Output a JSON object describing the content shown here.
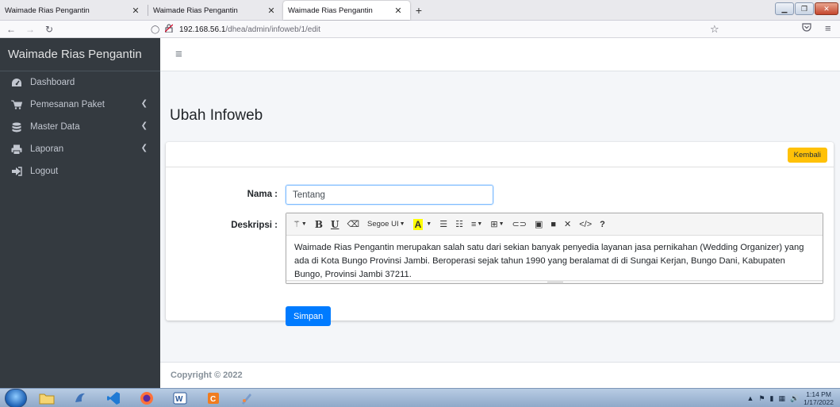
{
  "browser": {
    "tabs": [
      {
        "title": "Waimade Rias Pengantin",
        "active": false
      },
      {
        "title": "Waimade Rias Pengantin",
        "active": false
      },
      {
        "title": "Waimade Rias Pengantin",
        "active": true
      }
    ],
    "url_host": "192.168.56.1",
    "url_path": "/dhea/admin/infoweb/1/edit"
  },
  "sidebar": {
    "brand": "Waimade Rias Pengantin",
    "items": [
      {
        "label": "Dashboard",
        "icon": "dashboard-icon",
        "has_arrow": false
      },
      {
        "label": "Pemesanan Paket",
        "icon": "cart-icon",
        "has_arrow": true
      },
      {
        "label": "Master Data",
        "icon": "database-icon",
        "has_arrow": true
      },
      {
        "label": "Laporan",
        "icon": "print-icon",
        "has_arrow": true
      },
      {
        "label": "Logout",
        "icon": "sign-out-icon",
        "has_arrow": false
      }
    ]
  },
  "page": {
    "title": "Ubah Infoweb",
    "back_button": "Kembali",
    "form": {
      "nama_label": "Nama :",
      "nama_value": "Tentang",
      "deskripsi_label": "Deskripsi :",
      "deskripsi_value": "Waimade Rias Pengantin merupakan salah satu dari sekian banyak penyedia layanan jasa pernikahan (Wedding Organizer) yang ada di Kota Bungo Provinsi Jambi. Beroperasi sejak tahun 1990 yang beralamat di di Sungai Kerjan, Bungo Dani, Kabupaten Bungo, Provinsi Jambi 37211.",
      "editor_font": "Segoe UI",
      "save_button": "Simpan"
    }
  },
  "footer": {
    "text": "Copyright © 2022"
  },
  "taskbar": {
    "time": "1:14 PM",
    "date": "1/17/2022"
  },
  "colors": {
    "sidebar": "#343a40",
    "primary": "#007bff",
    "warning": "#ffc107"
  }
}
